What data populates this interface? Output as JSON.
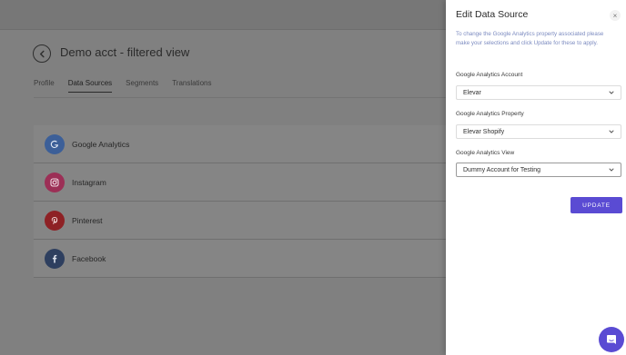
{
  "page": {
    "title": "Demo acct - filtered view",
    "tabs": [
      "Profile",
      "Data Sources",
      "Segments",
      "Translations"
    ],
    "active_tab": "Data Sources"
  },
  "sources": [
    {
      "name": "Google Analytics",
      "icon": "google-icon",
      "color": "#4285f4"
    },
    {
      "name": "Instagram",
      "icon": "instagram-icon",
      "color": "#e1306c"
    },
    {
      "name": "Pinterest",
      "icon": "pinterest-icon",
      "color": "#e60023"
    },
    {
      "name": "Facebook",
      "icon": "facebook-icon",
      "color": "#3b5998"
    }
  ],
  "panel": {
    "title": "Edit Data Source",
    "close_label": "×",
    "description": "To change the Google Analytics property associated please make your selections and click Update for these to apply.",
    "fields": [
      {
        "label": "Google Analytics Account",
        "value": "Elevar"
      },
      {
        "label": "Google Analytics Property",
        "value": "Elevar Shopify"
      },
      {
        "label": "Google Analytics View",
        "value": "Dummy Account for Testing"
      }
    ],
    "update_label": "UPDATE"
  },
  "colors": {
    "accent": "#5a4bd3",
    "description_text": "#7c8bc0"
  }
}
